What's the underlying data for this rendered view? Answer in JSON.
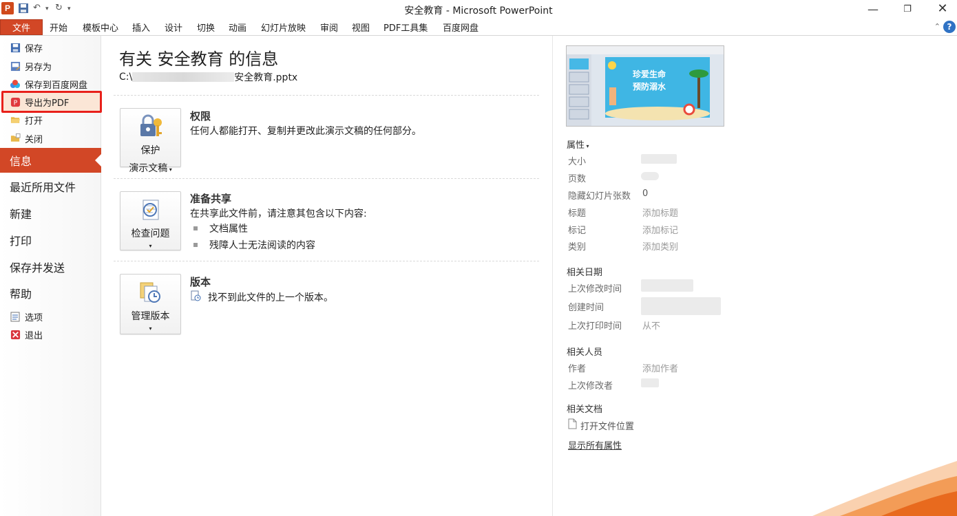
{
  "window": {
    "title": "安全教育 - Microsoft PowerPoint",
    "app_icon_letter": "P"
  },
  "ribbon": {
    "tabs": [
      "文件",
      "开始",
      "模板中心",
      "插入",
      "设计",
      "切换",
      "动画",
      "幻灯片放映",
      "审阅",
      "视图",
      "PDF工具集",
      "百度网盘"
    ],
    "help_label": "?"
  },
  "backstage_nav": {
    "save": "保存",
    "save_as": "另存为",
    "save_to_baidu": "保存到百度网盘",
    "export_pdf": "导出为PDF",
    "open": "打开",
    "close": "关闭",
    "info": "信息",
    "recent": "最近所用文件",
    "new": "新建",
    "print": "打印",
    "save_send": "保存并发送",
    "help": "帮助",
    "options": "选项",
    "exit": "退出",
    "active": "信息",
    "highlighted": "另存为"
  },
  "info": {
    "heading": "有关 安全教育 的信息",
    "path_prefix": "C:\\",
    "path_suffix": "安全教育.pptx",
    "permissions": {
      "button_line1": "保护",
      "button_line2": "演示文稿",
      "title": "权限",
      "text": "任何人都能打开、复制并更改此演示文稿的任何部分。"
    },
    "prepare": {
      "button_line1": "检查问题",
      "title": "准备共享",
      "text": "在共享此文件前，请注意其包含以下内容:",
      "bullets": [
        "文档属性",
        "残障人士无法阅读的内容"
      ]
    },
    "versions": {
      "button_line1": "管理版本",
      "title": "版本",
      "text": "找不到此文件的上一个版本。"
    }
  },
  "properties": {
    "header": "属性",
    "size_label": "大小",
    "pages_label": "页数",
    "hidden_slides_label": "隐藏幻灯片张数",
    "hidden_slides_value": "0",
    "title_label": "标题",
    "title_value": "添加标题",
    "tags_label": "标记",
    "tags_value": "添加标记",
    "category_label": "类别",
    "category_value": "添加类别",
    "dates_header": "相关日期",
    "modified_label": "上次修改时间",
    "created_label": "创建时间",
    "printed_label": "上次打印时间",
    "printed_value": "从不",
    "people_header": "相关人员",
    "author_label": "作者",
    "author_value": "添加作者",
    "last_modified_by_label": "上次修改者",
    "docs_header": "相关文档",
    "open_location": "打开文件位置",
    "show_all": "显示所有属性"
  },
  "thumbnail": {
    "line1": "珍爱生命",
    "line2": "预防溺水"
  },
  "colors": {
    "accent": "#d24726",
    "highlight_box": "#e8201a"
  }
}
